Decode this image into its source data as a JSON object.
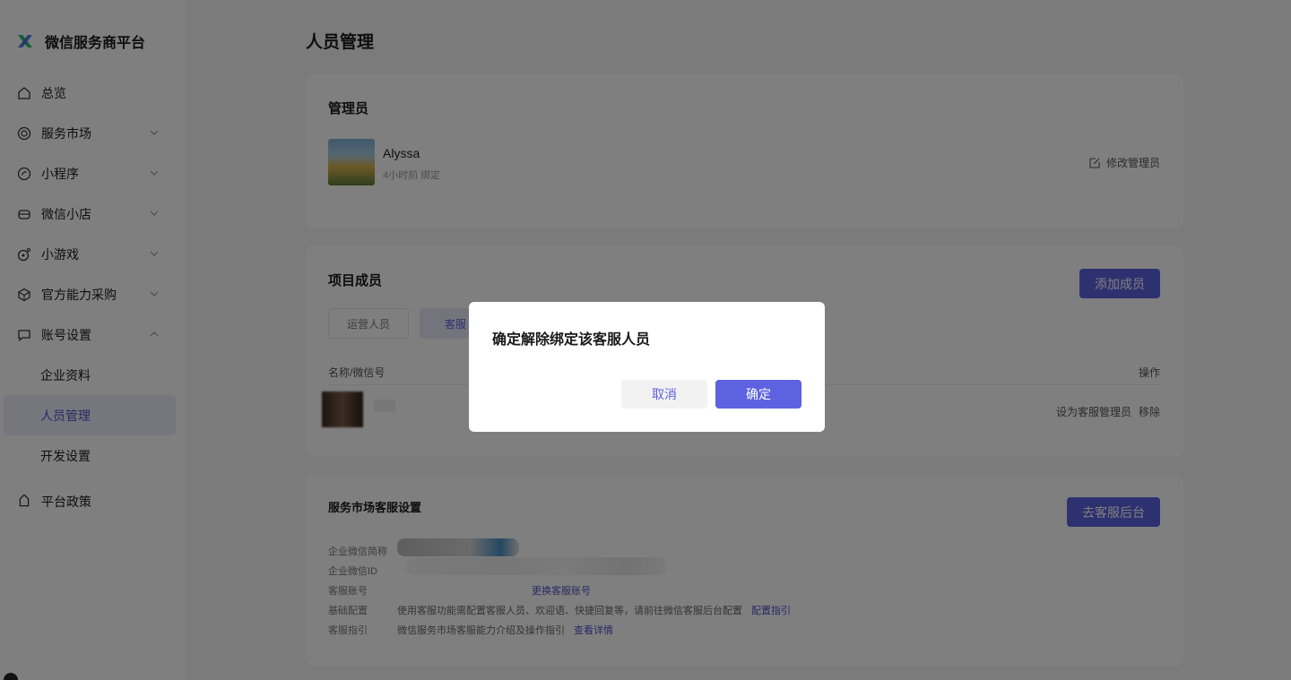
{
  "sidebar": {
    "brand": "微信服务商平台",
    "items": [
      {
        "label": "总览",
        "icon": "home-icon"
      },
      {
        "label": "服务市场",
        "icon": "market-icon",
        "chevron": "down"
      },
      {
        "label": "小程序",
        "icon": "miniprogram-icon",
        "chevron": "down"
      },
      {
        "label": "微信小店",
        "icon": "shop-icon",
        "chevron": "down"
      },
      {
        "label": "小游戏",
        "icon": "game-icon",
        "chevron": "down"
      },
      {
        "label": "官方能力采购",
        "icon": "cube-icon",
        "chevron": "down"
      },
      {
        "label": "账号设置",
        "icon": "chat-icon",
        "chevron": "up"
      }
    ],
    "sub_items": [
      {
        "label": "企业资料"
      },
      {
        "label": "人员管理",
        "active": true
      },
      {
        "label": "开发设置"
      }
    ],
    "policy": {
      "label": "平台政策",
      "icon": "tag-icon"
    }
  },
  "page": {
    "title": "人员管理"
  },
  "admin": {
    "title": "管理员",
    "name": "Alyssa",
    "time": "4小时前 绑定",
    "edit_label": "修改管理员"
  },
  "members": {
    "title": "项目成员",
    "add_label": "添加成员",
    "tabs": [
      "运营人员",
      "客服"
    ],
    "col_name": "名称/微信号",
    "col_op": "操作",
    "action_set": "设为客服管理员",
    "action_remove": "移除"
  },
  "service": {
    "title": "服务市场客服设置",
    "goto_label": "去客服后台",
    "rows": {
      "short_name": "企业微信简称",
      "corp_id": "企业微信ID",
      "account": "客服账号",
      "account_link": "更换客服账号",
      "basic": "基础配置",
      "basic_text": "使用客服功能需配置客服人员、欢迎语、快捷回复等，请前往微信客服后台配置",
      "basic_link": "配置指引",
      "guide": "客服指引",
      "guide_text": "微信服务市场客服能力介绍及操作指引",
      "guide_link": "查看详情"
    }
  },
  "dialog": {
    "title": "确定解除绑定该客服人员",
    "cancel": "取消",
    "ok": "确定"
  },
  "colors": {
    "accent": "#5d62e0",
    "overlay": "rgba(0,0,0,0.5)"
  }
}
